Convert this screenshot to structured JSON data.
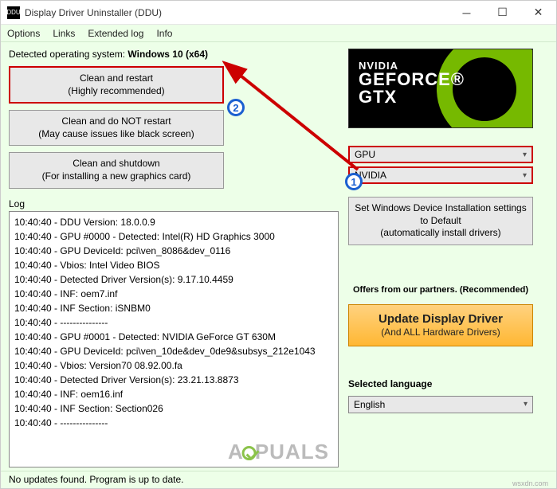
{
  "window": {
    "title": "Display Driver Uninstaller (DDU)"
  },
  "menu": {
    "options": "Options",
    "links": "Links",
    "extended_log": "Extended log",
    "info": "Info"
  },
  "detected_label": "Detected operating system: ",
  "detected_os": "Windows 10 (x64)",
  "buttons": {
    "clean_restart_line1": "Clean and restart",
    "clean_restart_line2": "(Highly recommended)",
    "clean_norestart_line1": "Clean and do NOT restart",
    "clean_norestart_line2": "(May cause issues like black screen)",
    "clean_shutdown_line1": "Clean and shutdown",
    "clean_shutdown_line2": "(For installing a new graphics card)"
  },
  "log_label": "Log",
  "log": [
    "10:40:40 - DDU Version: 18.0.0.9",
    "10:40:40 - GPU #0000 - Detected: Intel(R) HD Graphics 3000",
    "10:40:40 - GPU DeviceId: pci\\ven_8086&dev_0116",
    "10:40:40 - Vbios: Intel Video BIOS",
    "10:40:40 - Detected Driver Version(s): 9.17.10.4459",
    "10:40:40 - INF: oem7.inf",
    "10:40:40 - INF Section: iSNBM0",
    "10:40:40 - ---------------",
    "10:40:40 - GPU #0001 - Detected: NVIDIA GeForce GT 630M",
    "10:40:40 - GPU DeviceId: pci\\ven_10de&dev_0de9&subsys_212e1043",
    "10:40:40 - Vbios: Version70 08.92.00.fa",
    "10:40:40 - Detected Driver Version(s): 23.21.13.8873",
    "10:40:40 - INF: oem16.inf",
    "10:40:40 - INF Section: Section026",
    "10:40:40 - ---------------"
  ],
  "gfx": {
    "line1": "NVIDIA",
    "line2": "GEFORCE®",
    "line3": "GTX"
  },
  "select": {
    "device_type": "GPU",
    "vendor": "NVIDIA"
  },
  "setdefault": {
    "line1": "Set Windows Device Installation settings",
    "line2": "to Default",
    "line3": "(automatically install drivers)"
  },
  "offers_label": "Offers from our partners. (Recommended)",
  "update": {
    "line1": "Update Display Driver",
    "line2": "(And ALL Hardware Drivers)"
  },
  "lang_label": "Selected language",
  "lang_value": "English",
  "status": "No updates found. Program is up to date.",
  "markers": {
    "one": "1",
    "two": "2"
  },
  "watermark": "wsxdn.com"
}
